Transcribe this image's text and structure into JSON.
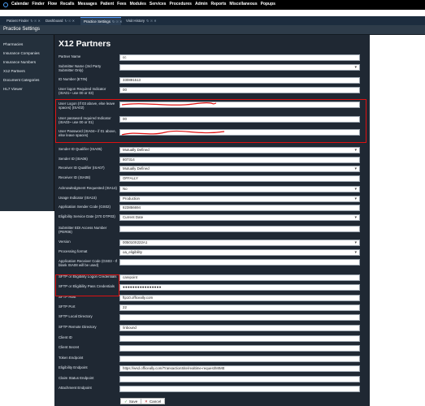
{
  "menu": [
    "Calendar",
    "Finder",
    "Flow",
    "Recalls",
    "Messages",
    "Patient",
    "Fees",
    "Modules",
    "Services",
    "Procedures",
    "Admin",
    "Reports",
    "Miscellaneous",
    "Popups"
  ],
  "tabs": [
    {
      "label": "Patient Finder",
      "active": false
    },
    {
      "label": "Dashboard",
      "active": false
    },
    {
      "label": "Practice Settings",
      "active": true
    },
    {
      "label": "Visit History",
      "active": false
    }
  ],
  "header": {
    "title": "Practice Settings"
  },
  "sidebar": {
    "items": [
      "Pharmacies",
      "Insurance Companies",
      "Insurance Numbers",
      "X12 Partners",
      "Document Categories",
      "HL7 Viewer"
    ]
  },
  "page_title": "X12 Partners",
  "fields": [
    {
      "label": "Partner Name",
      "value": "cc",
      "type": "text"
    },
    {
      "label": "Submitter Name (3rd Party Submitter Only)",
      "value": "",
      "type": "select"
    },
    {
      "label": "ID Number (ETIN)",
      "value": "330891513",
      "type": "text"
    },
    {
      "label": "User logon Required Indicator (ISA01~ use 00 or 03)",
      "value": "00",
      "type": "text"
    },
    {
      "label": "User Logon (If 03 above, else leave spaces) (ISA02)",
      "value": "",
      "type": "text"
    },
    {
      "label": "User password required Indicator (ISA03~ use 00 or 01)",
      "value": "00",
      "type": "text"
    },
    {
      "label": "User Password (ISA04~ if 01 above, else leave spaces)",
      "value": "",
      "type": "text"
    },
    {
      "label": "Sender ID Qualifier (ISA05)",
      "value": "Mutually Defined",
      "type": "select"
    },
    {
      "label": "Sender ID (ISA06)",
      "value": "807314",
      "type": "text"
    },
    {
      "label": "Receiver ID Qualifier (ISA07)",
      "value": "Mutually Defined",
      "type": "select"
    },
    {
      "label": "Receiver ID (ISA08)",
      "value": "OFFALLY",
      "type": "text"
    },
    {
      "label": "Acknowledgment Requested (ISA14)",
      "value": "No",
      "type": "select"
    },
    {
      "label": "Usage Indicator (ISA15)",
      "value": "Production",
      "type": "select"
    },
    {
      "label": "Application Sender Code (GS02)",
      "value": "823856694",
      "type": "text"
    },
    {
      "label": "Eligibility Service Date (270 DTP03)",
      "value": "Current Date",
      "type": "select"
    },
    {
      "label": "Submitter EDI Access Number (PER06)",
      "value": "",
      "type": "text"
    },
    {
      "label": "Version",
      "value": "005010X222A1",
      "type": "select"
    },
    {
      "label": "Processing format",
      "value": "oa_eligibility",
      "type": "select"
    },
    {
      "label": "Application Receiver Code (GS03 - If blank ISA08 will be used)",
      "value": "",
      "type": "text"
    },
    {
      "label": "SFTP or Eligibility Logon Credentials",
      "value": "carepoint",
      "type": "text"
    },
    {
      "label": "SFTP or Eligibility Pass Credentials",
      "value": "●●●●●●●●●●●●●●●●",
      "type": "password"
    },
    {
      "label": "SFTP Host",
      "value": "ftp10.officeally.com",
      "type": "text"
    },
    {
      "label": "SFTP Port",
      "value": "22",
      "type": "text"
    },
    {
      "label": "SFTP Local Directory",
      "value": "",
      "type": "text"
    },
    {
      "label": "SFTP Remote Directory",
      "value": "/inbound",
      "type": "text"
    },
    {
      "label": "Client ID",
      "value": "",
      "type": "text"
    },
    {
      "label": "Client Secret",
      "value": "",
      "type": "text"
    },
    {
      "label": "Token Endpoint",
      "value": "",
      "type": "text"
    },
    {
      "label": "Eligibility Endpoint",
      "value": "https://wsd.officeally.com/TransactionSite/realtime-request/MIME",
      "type": "text"
    },
    {
      "label": "Claim Status Endpoint",
      "value": "",
      "type": "text"
    },
    {
      "label": "Attachment Endpoint",
      "value": "",
      "type": "text"
    }
  ],
  "buttons": {
    "save": "Save",
    "cancel": "Cancel"
  },
  "colors": {
    "accent": "#5aa0ff",
    "highlight": "#dd1111",
    "panel": "#1f2833"
  },
  "icons": {
    "save": "check-icon",
    "cancel": "close-icon",
    "tab_controls": "refresh-icon pin-icon close-icon"
  }
}
